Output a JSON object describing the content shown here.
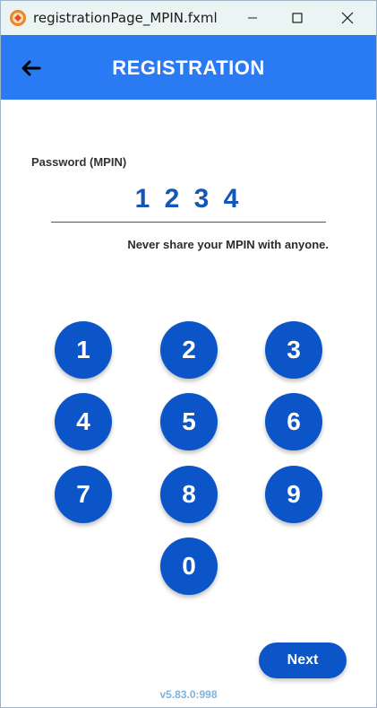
{
  "window": {
    "title": "registrationPage_MPIN.fxml"
  },
  "header": {
    "title": "REGISTRATION"
  },
  "form": {
    "password_label": "Password (MPIN)",
    "password_value": "1 2 3 4",
    "hint": "Never share your MPIN with anyone."
  },
  "keypad": {
    "keys": [
      "1",
      "2",
      "3",
      "4",
      "5",
      "6",
      "7",
      "8",
      "9",
      "0"
    ]
  },
  "footer": {
    "next_label": "Next",
    "version": "v5.83.0:998"
  },
  "colors": {
    "header": "#2a7af3",
    "key": "#0b55c9",
    "titlebar": "#e9f4f3"
  }
}
